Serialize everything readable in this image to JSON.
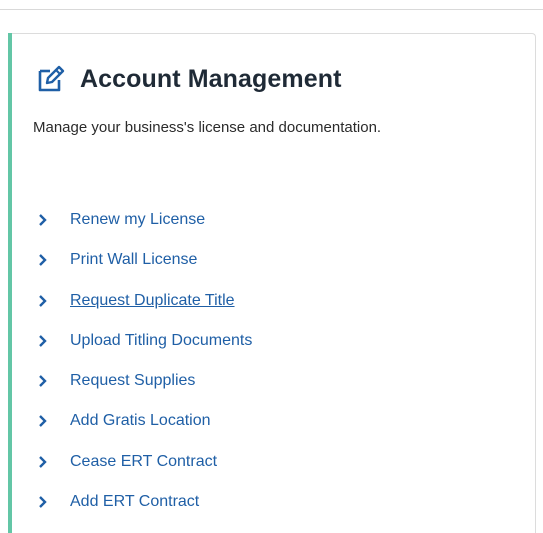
{
  "card": {
    "icon": "edit-square-icon",
    "title": "Account Management",
    "description": "Manage your business's license and documentation.",
    "accent_color": "#63c6a6",
    "link_color": "#1f5fa6"
  },
  "links": [
    {
      "label": "Renew my License",
      "icon": "chevron-right-icon",
      "underlined": false
    },
    {
      "label": "Print Wall License",
      "icon": "chevron-right-icon",
      "underlined": false
    },
    {
      "label": "Request Duplicate Title",
      "icon": "chevron-right-icon",
      "underlined": true
    },
    {
      "label": "Upload Titling Documents",
      "icon": "chevron-right-icon",
      "underlined": false
    },
    {
      "label": "Request Supplies",
      "icon": "chevron-right-icon",
      "underlined": false
    },
    {
      "label": "Add Gratis Location",
      "icon": "chevron-right-icon",
      "underlined": false
    },
    {
      "label": "Cease ERT Contract",
      "icon": "chevron-right-icon",
      "underlined": false
    },
    {
      "label": "Add ERT Contract",
      "icon": "chevron-right-icon",
      "underlined": false
    }
  ]
}
